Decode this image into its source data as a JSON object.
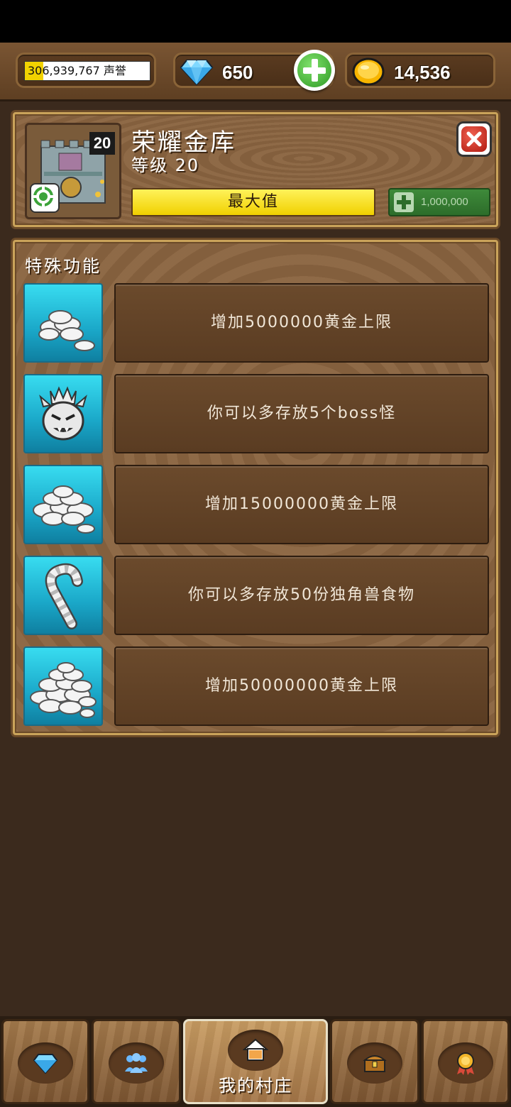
{
  "resources": {
    "reputation_value": "306,939,767",
    "reputation_label": "声誉",
    "reputation_fill": 0.15,
    "gems": "650",
    "gold": "14,536"
  },
  "building": {
    "name": "荣耀金库",
    "level_text": "等级 20",
    "level_badge": "20",
    "progress_label": "最大值",
    "upgrade_cost": "1,000,000"
  },
  "features": {
    "title": "特殊功能",
    "items": [
      {
        "text": "增加5000000黄金上限",
        "icon": "coins-small-icon"
      },
      {
        "text": "你可以多存放5个boss怪",
        "icon": "boss-monster-icon"
      },
      {
        "text": "增加15000000黄金上限",
        "icon": "coins-medium-icon"
      },
      {
        "text": "你可以多存放50份独角兽食物",
        "icon": "candy-cane-icon"
      },
      {
        "text": "增加50000000黄金上限",
        "icon": "coins-large-icon"
      }
    ]
  },
  "nav": {
    "items": [
      {
        "icon": "diamond-icon"
      },
      {
        "icon": "friends-icon"
      },
      {
        "icon": "home-icon",
        "label": "我的村庄"
      },
      {
        "icon": "treasure-chest-icon"
      },
      {
        "icon": "medal-icon"
      }
    ]
  },
  "colors": {
    "accent_gold": "#f0d000",
    "feature_icon_bg": "#1aa7c8",
    "upgrade_green": "#2d6d2a",
    "close_red": "#b01a10"
  }
}
